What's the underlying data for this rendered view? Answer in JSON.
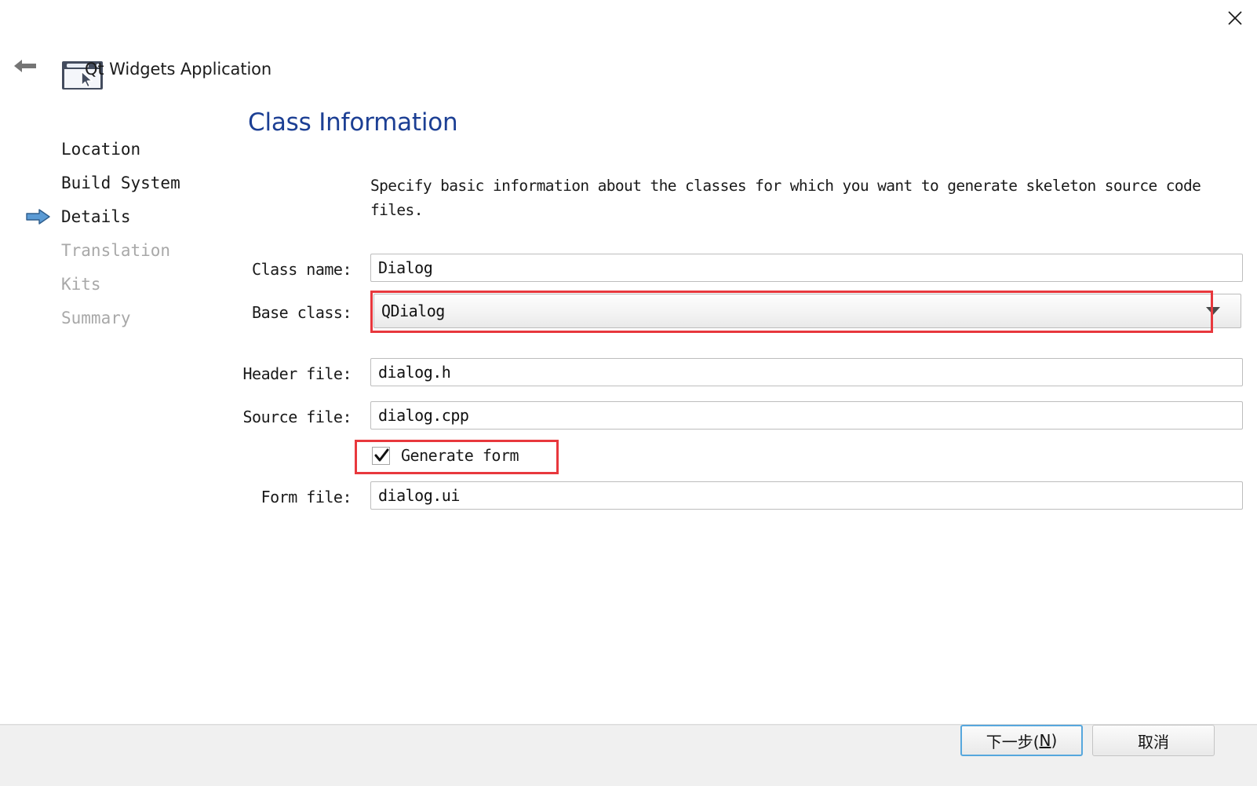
{
  "window": {
    "title": "Qt Widgets Application",
    "close_label": "×",
    "back_label": "back-arrow"
  },
  "sidebar": {
    "items": [
      {
        "label": "Location",
        "state": "done"
      },
      {
        "label": "Build System",
        "state": "done"
      },
      {
        "label": "Details",
        "state": "current"
      },
      {
        "label": "Translation",
        "state": "disabled"
      },
      {
        "label": "Kits",
        "state": "disabled"
      },
      {
        "label": "Summary",
        "state": "disabled"
      }
    ]
  },
  "page": {
    "title": "Class Information",
    "description": "Specify basic information about the classes for which you want to generate skeleton source code files."
  },
  "form": {
    "class_name": {
      "label": "Class name:",
      "value": "Dialog"
    },
    "base_class": {
      "label": "Base class:",
      "value": "QDialog",
      "icon": "chevron-down-icon"
    },
    "header_file": {
      "label": "Header file:",
      "value": "dialog.h"
    },
    "source_file": {
      "label": "Source file:",
      "value": "dialog.cpp"
    },
    "generate_form": {
      "label": "Generate form",
      "checked": true
    },
    "form_file": {
      "label": "Form file:",
      "value": "dialog.ui"
    }
  },
  "footer": {
    "next_label": "下一步(",
    "next_accel": "N",
    "next_label_end": ")",
    "cancel_label": "取消"
  },
  "colors": {
    "title_blue": "#1c3f94",
    "highlight_red": "#e8383d",
    "focus_blue": "#56a7dd",
    "marker_blue": "#5b9bd5"
  }
}
